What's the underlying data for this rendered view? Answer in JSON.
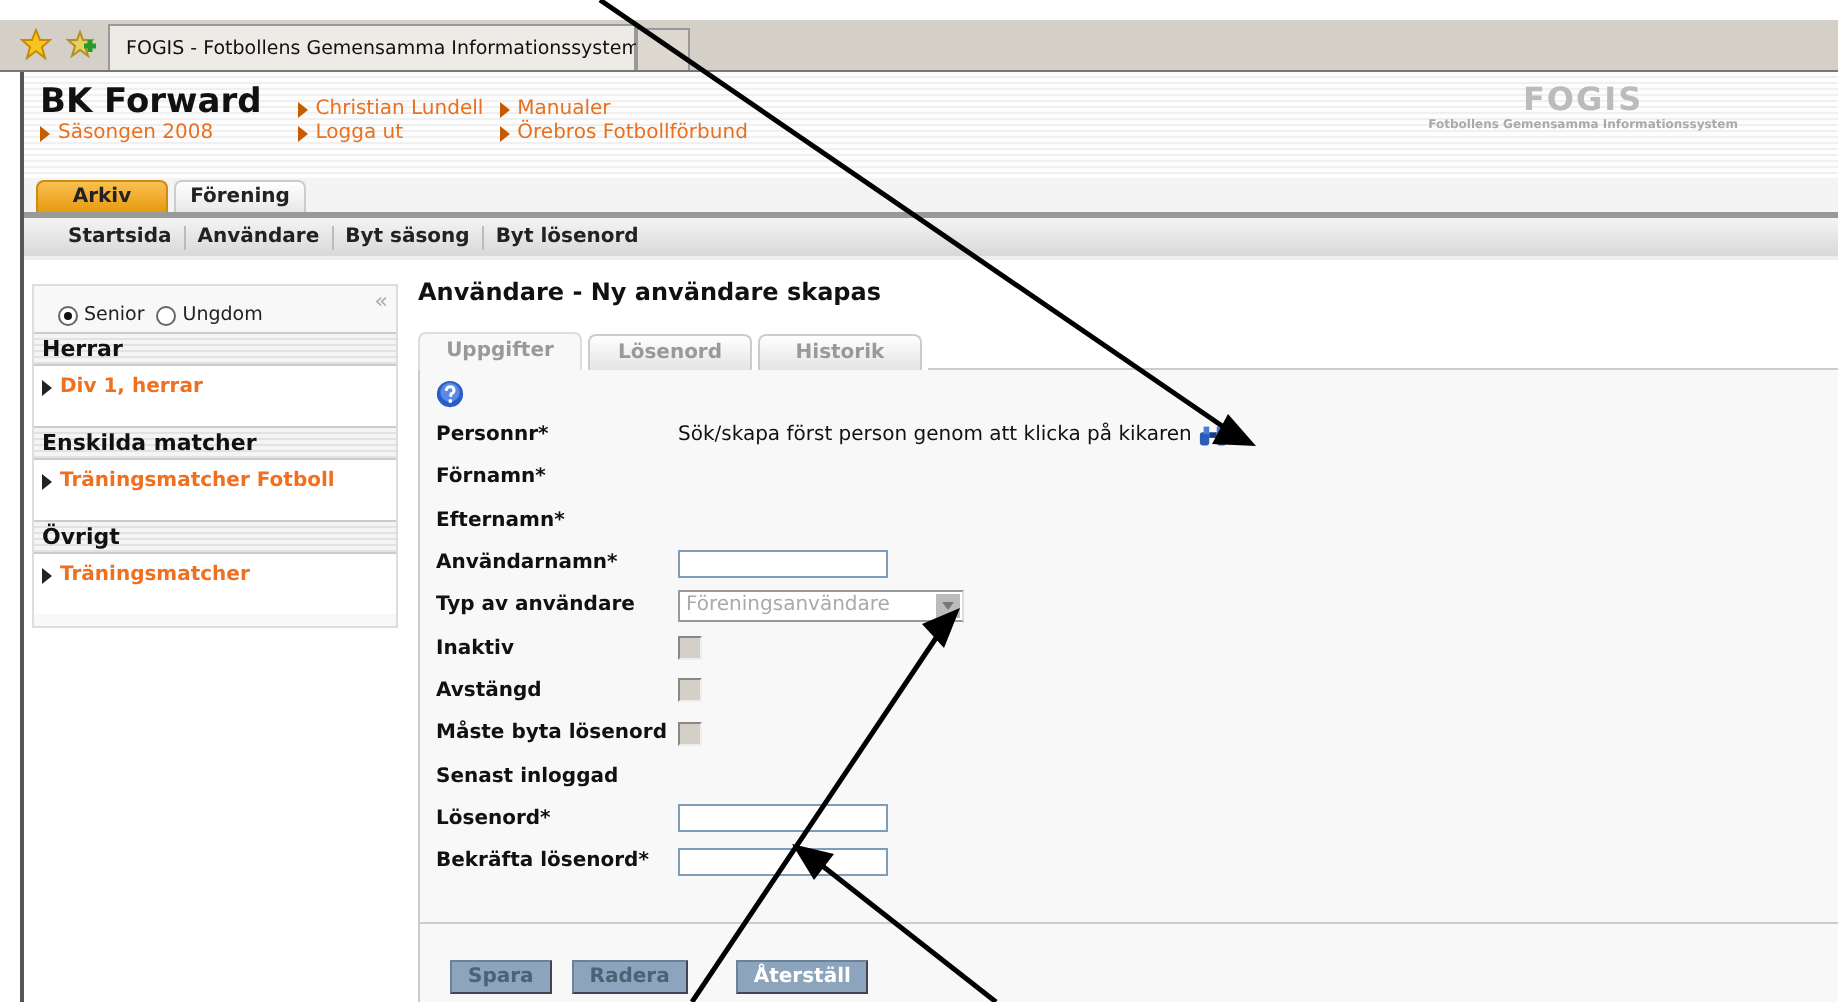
{
  "browser": {
    "tab_title": "FOGIS - Fotbollens Gemensamma Informationssystem"
  },
  "header": {
    "club": "BK Forward",
    "season": "Säsongen 2008",
    "links": [
      {
        "label": "Christian Lundell"
      },
      {
        "label": "Manualer"
      },
      {
        "label": "Logga ut"
      },
      {
        "label": "Örebros Fotbollförbund"
      }
    ],
    "logo": {
      "title": "FOGIS",
      "subtitle": "Fotbollens Gemensamma Informationssystem"
    }
  },
  "main_tabs": [
    {
      "label": "Arkiv",
      "selected": true
    },
    {
      "label": "Förening",
      "selected": false
    }
  ],
  "sub_nav": [
    "Startsida",
    "Användare",
    "Byt säsong",
    "Byt lösenord"
  ],
  "sidebar": {
    "collapse": "«",
    "radios": [
      {
        "label": "Senior",
        "selected": true
      },
      {
        "label": "Ungdom",
        "selected": false
      }
    ],
    "sections": [
      {
        "title": "Herrar",
        "items": [
          "Div 1, herrar"
        ]
      },
      {
        "title": "Enskilda matcher",
        "items": [
          "Träningsmatcher Fotboll"
        ]
      },
      {
        "title": "Övrigt",
        "items": [
          "Träningsmatcher"
        ]
      }
    ]
  },
  "page_title": "Användare - Ny användare skapas",
  "form_tabs": [
    {
      "label": "Uppgifter",
      "selected": true
    },
    {
      "label": "Lösenord",
      "selected": false
    },
    {
      "label": "Historik",
      "selected": false
    }
  ],
  "form_rows": [
    {
      "label": "Personnr*",
      "kind": "search",
      "text": "Sök/skapa först person genom att klicka på kikaren"
    },
    {
      "label": "Förnamn*",
      "kind": "plain"
    },
    {
      "label": "Efternamn*",
      "kind": "plain"
    },
    {
      "label": "Användarnamn*",
      "kind": "input"
    },
    {
      "label": "Typ av användare",
      "kind": "select",
      "value": "Föreningsanvändare",
      "disabled": true
    },
    {
      "label": "Inaktiv",
      "kind": "checkbox",
      "checked": false,
      "disabled": true
    },
    {
      "label": "Avstängd",
      "kind": "checkbox",
      "checked": false,
      "disabled": true
    },
    {
      "label": "Måste byta lösenord",
      "kind": "checkbox",
      "checked": false,
      "disabled": true
    },
    {
      "label": "Senast inloggad",
      "kind": "plain"
    },
    {
      "label": "Lösenord*",
      "kind": "input"
    },
    {
      "label": "Bekräfta lösenord*",
      "kind": "input"
    }
  ],
  "buttons": [
    {
      "label": "Spara",
      "disabled": true
    },
    {
      "label": "Radera",
      "disabled": true
    },
    {
      "label": "Återställ",
      "disabled": false
    }
  ]
}
